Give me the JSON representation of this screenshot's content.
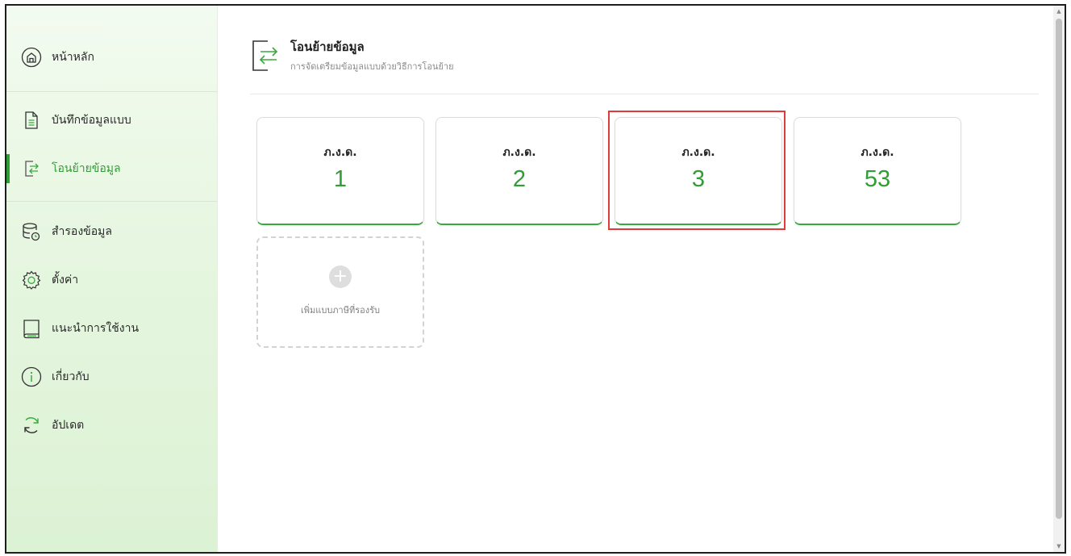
{
  "sidebar": {
    "items": [
      {
        "label": "หน้าหลัก",
        "icon": "home-icon"
      },
      {
        "label": "บันทึกข้อมูลแบบ",
        "icon": "document-icon"
      },
      {
        "label": "โอนย้ายข้อมูล",
        "icon": "transfer-icon",
        "active": true
      },
      {
        "label": "สำรองข้อมูล",
        "icon": "database-backup-icon"
      },
      {
        "label": "ตั้งค่า",
        "icon": "gear-icon"
      },
      {
        "label": "แนะนำการใช้งาน",
        "icon": "book-icon"
      },
      {
        "label": "เกี่ยวกับ",
        "icon": "info-icon"
      },
      {
        "label": "อัปเดต",
        "icon": "refresh-icon"
      }
    ]
  },
  "page": {
    "title": "โอนย้ายข้อมูล",
    "subtitle": "การจัดเตรียมข้อมูลแบบด้วยวิธีการโอนย้าย",
    "icon": "transfer-icon"
  },
  "cards": [
    {
      "name": "ภ.ง.ด.",
      "number": "1"
    },
    {
      "name": "ภ.ง.ด.",
      "number": "2"
    },
    {
      "name": "ภ.ง.ด.",
      "number": "3",
      "highlighted": true
    },
    {
      "name": "ภ.ง.ด.",
      "number": "53"
    }
  ],
  "add_card": {
    "label": "เพิ่มแบบภาษีที่รองรับ",
    "icon": "plus-icon"
  },
  "colors": {
    "accent": "#2f9e34",
    "highlight": "#e03a3a",
    "sidebar_bg": "#e6f6e0"
  }
}
